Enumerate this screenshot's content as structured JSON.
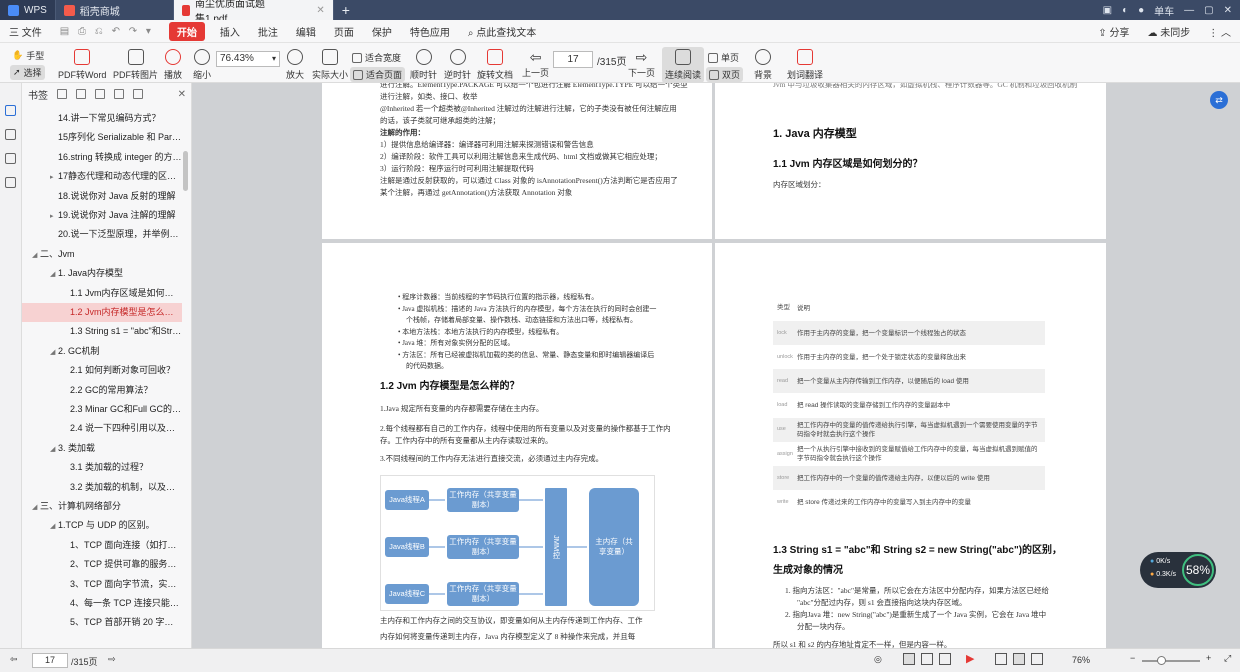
{
  "tabs": {
    "app": "WPS",
    "store": "稻壳商城",
    "doc": "南尘优质面试题集1.pdf",
    "add": "+",
    "user": "单车"
  },
  "menu": {
    "file": "三 文件",
    "items": [
      "开始",
      "插入",
      "批注",
      "编辑",
      "页面",
      "保护",
      "特色应用"
    ],
    "search": "点此查找文本",
    "share": "分享",
    "sync": "未同步"
  },
  "toolbar": {
    "hand": "手型",
    "select": "选择",
    "pdf_word": "PDF转Word",
    "pdf_img": "PDF转图片",
    "play": "播放",
    "zoom_out": "缩小",
    "zoom": "76.43%",
    "zoom_in": "放大",
    "actual": "实际大小",
    "fit_width": "适合宽度",
    "fit_page": "适合页面",
    "cw": "顺时针",
    "ccw": "逆时针",
    "rotate": "旋转文档",
    "prev": "上一页",
    "page": "17",
    "total": "/315页",
    "next": "下一页",
    "continuous": "连续阅读",
    "single": "单页",
    "double": "双页",
    "bg": "背景",
    "translate": "划词翻译"
  },
  "sidebar": {
    "title": "书签",
    "items": [
      {
        "t": "14.讲一下常见编码方式？",
        "lvl": 2
      },
      {
        "t": "15序列化 Serializable 和 Parcel...",
        "lvl": 2
      },
      {
        "t": "16.string 转换成 integer 的方式...",
        "lvl": 2
      },
      {
        "t": "17静态代理和动态代理的区别，...",
        "lvl": 1,
        "tri": "▸"
      },
      {
        "t": "18.说说你对 Java 反射的理解",
        "lvl": 2
      },
      {
        "t": "19.说说你对 Java 注解的理解",
        "lvl": 1,
        "tri": "▸"
      },
      {
        "t": "20.说一下泛型原理，并举例说明",
        "lvl": 2
      },
      {
        "t": "二、Jvm",
        "lvl": 0,
        "tri": "◂"
      },
      {
        "t": "1. Java内存模型",
        "lvl": 1,
        "tri": "◂"
      },
      {
        "t": "1.1 Jvm内存区域是如何划分...",
        "lvl": 3
      },
      {
        "t": "1.2 Jvm内存模型是怎么样的？",
        "lvl": 3,
        "sel": true
      },
      {
        "t": "1.3 String s1 = \"abc\"和Strin...",
        "lvl": 3
      },
      {
        "t": "2. GC机制",
        "lvl": 1,
        "tri": "◂"
      },
      {
        "t": "2.1 如何判断对象可回收？",
        "lvl": 3
      },
      {
        "t": "2.2 GC的常用算法？",
        "lvl": 3
      },
      {
        "t": "2.3 Minar GC和Full GC的区...",
        "lvl": 3
      },
      {
        "t": "2.4 说一下四种引用以及他们...",
        "lvl": 3
      },
      {
        "t": "3. 类加载",
        "lvl": 1,
        "tri": "◂"
      },
      {
        "t": "3.1 类加载的过程？",
        "lvl": 3
      },
      {
        "t": "3.2 类加载的机制，以及为什...",
        "lvl": 3
      },
      {
        "t": "三、计算机网络部分",
        "lvl": 0,
        "tri": "◂"
      },
      {
        "t": "1.TCP 与 UDP 的区别。",
        "lvl": 1,
        "tri": "◂"
      },
      {
        "t": "1、TCP 面向连接（如打电话...",
        "lvl": 3
      },
      {
        "t": "2、TCP 提供可靠的服务。也...",
        "lvl": 3
      },
      {
        "t": "3、TCP 面向字节流，实际上...",
        "lvl": 3
      },
      {
        "t": "4、每一条 TCP 连接只能是点...",
        "lvl": 3
      },
      {
        "t": "5、TCP 首部开销 20 字节;U...",
        "lvl": 3
      }
    ]
  },
  "page1": {
    "lines": [
      "进行注解。ElementType.PACKAGE 可以给一个包进行注解 ElementType.TYPE 可以给一个类型",
      "进行注解，如类、接口、枚举",
      "@Inherited 若一个超类被@Inherited 注解过的注解进行注解，它的子类没有被任何注解应用",
      "的话，该子类就可继承超类的注解；",
      "注解的作用：",
      "1）提供信息给编译器：编译器可利用注解来探测错误和警告信息",
      "2）编译阶段：软件工具可以利用注解信息来生成代码、html 文档或做其它相应处理；",
      "3）运行阶段：程序运行时可利用注解提取代码",
      "注解是通过反射获取的，可以通过 Class 对象的 isAnnotationPresent()方法判断它是否应用了",
      "某个注解，再通过 getAnnotation()方法获取 Annotation 对象"
    ]
  },
  "page2": {
    "top": "Jvm 中与垃圾收集器相关的内存区域，如虚拟机栈、程序计数器等。GC 机制和垃圾回收机制",
    "h1": "1. Java 内存模型",
    "h2": "1.1 Jvm 内存区域是如何划分的？",
    "p": "内存区域划分："
  },
  "page3": {
    "bullets": [
      "程序计数器：当前线程的字节码执行位置的指示器，线程私有。",
      "Java 虚拟机栈：描述的 Java 方法执行的内存模型，每个方法在执行的同时会创建一",
      "个栈帧，存储着局部变量、操作数栈、动态链接和方法出口等，线程私有。",
      "本地方法栈：本地方法执行的内存模型，线程私有。",
      "Java 堆：所有对象实例分配的区域。",
      "方法区：所有已经被虚拟机加载的类的信息、常量、静态变量和即时编辑器编译后",
      "的代码数据。"
    ],
    "h": "1.2 Jvm 内存模型是怎么样的？",
    "p1": "1.Java 规定所有变量的内存都需要存储在主内存。",
    "p2a": "2.每个线程都有自己的工作内存，线程中使用的所有变量以及对变量的操作都基于工作内",
    "p2b": "存。工作内存中的所有变量都从主内存读取过来的。",
    "p3": "3.不同线程间的工作内存无法进行直接交流，必须通过主内存完成。",
    "diagram": {
      "threads": [
        "Java线程A",
        "Java线程B",
        "Java线程C"
      ],
      "work": "工作内存（共享变量副本）",
      "jmm": "JMM控",
      "main": "主内存（共享变量）"
    },
    "bottom1": "主内存和工作内存之间的交互协议，即变量如何从主内存传递到工作内存、工作",
    "bottom2": "内存如何将变量传递到主内存，Java 内存模型定义了 8 种操作来完成，并且每"
  },
  "page4": {
    "col1": "类型",
    "col2": "说明",
    "rows": [
      {
        "k": "lock",
        "v": "作用于主内存的变量，把一个变量标识一个线程独占的状态"
      },
      {
        "k": "unlock",
        "v": "作用于主内存的变量，把一个处于锁定状态的变量释放出来"
      },
      {
        "k": "read",
        "v": "把一个变量从主内存传输到工作内存，以便随后的 load 使用"
      },
      {
        "k": "load",
        "v": "把 read 操作读取的变量存储到工作内存的变量副本中"
      },
      {
        "k": "use",
        "v": "把工作内存中的变量的值传递给执行引擎，每当虚拟机遇到一个需要使用变量的字节码指令时就会执行这个操作"
      },
      {
        "k": "assign",
        "v": "把一个从执行引擎中接收到的变量赋值给工作内存中的变量，每当虚拟机遇到赋值的字节码指令就会执行这个操作"
      },
      {
        "k": "store",
        "v": "把工作内存中的一个变量的值传递给主内存，以便以后的 write 使用"
      },
      {
        "k": "write",
        "v": "把 store 传递过来的工作内存中的变量写入到主内存中的变量"
      }
    ],
    "h1": "1.3 String s1 = \"abc\"和 String s2 = new String(\"abc\")的区别，",
    "h2": "生成对象的情况",
    "l1": "1.  指向方法区：\"abc\"是常量，所以它会在方法区中分配内存，如果方法区已经给",
    "l2": "\"abc\"分配过内存，则 s1 会直接指向这块内存区域。",
    "l3": "2.  指向Java 堆：new String(\"abc\")是重新生成了一个 Java 实例，它会在 Java 堆中",
    "l4": "分配一块内存。",
    "l5": "所以 s1 和 s2 的内存地址肯定不一样，但是内容一样。"
  },
  "status": {
    "page": "17",
    "total": "/315页",
    "zoom": "76%",
    "zoom_minus": "−",
    "zoom_plus": "+"
  },
  "network": {
    "up": "0K/s",
    "down": "0.3K/s",
    "pct": "58%"
  },
  "colors": {
    "accent": "#e53935",
    "tabbar": "#3b4a66",
    "diagram": "#6b9bd1",
    "selected_bg": "#f7d2d2"
  }
}
